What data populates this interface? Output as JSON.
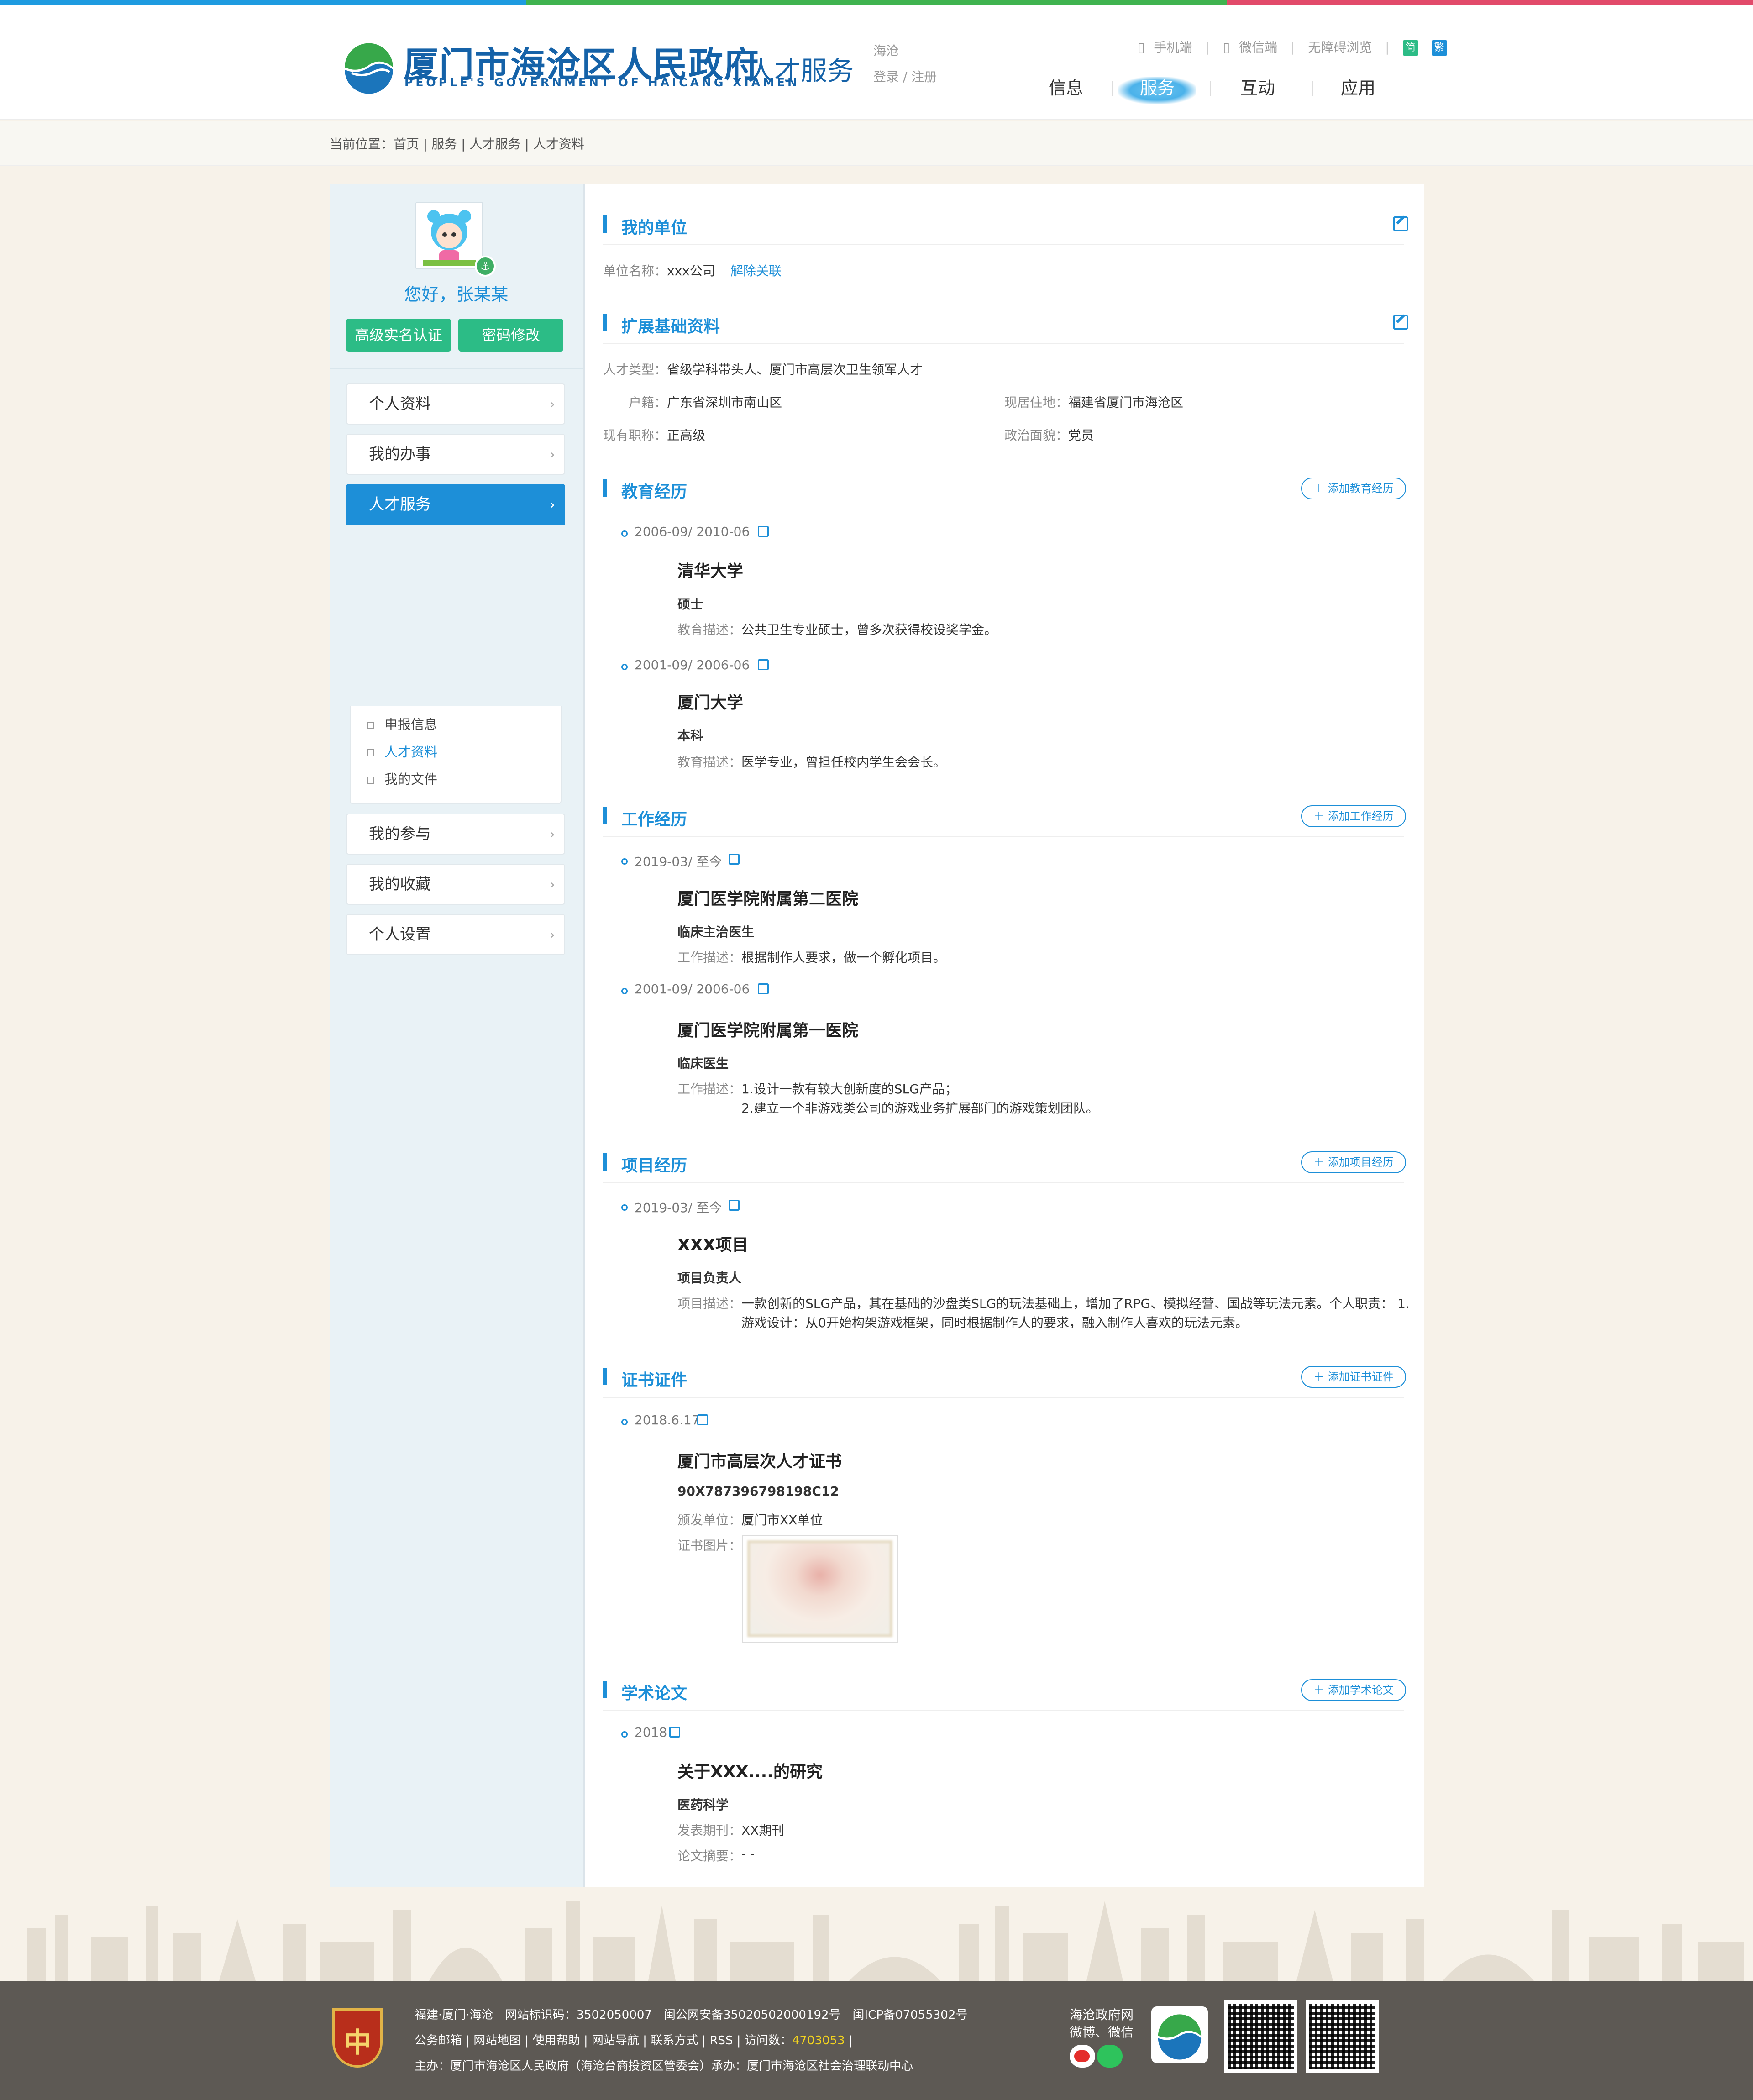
{
  "header": {
    "site_title": "厦门市海沧区人民政府",
    "site_title_en": "PEOPLE'S GOVERNMENT OF HAICANG XIAMEN",
    "section": "人才服务",
    "location": "海沧",
    "login": "登录 / 注册",
    "links": [
      "手机端",
      "微信端",
      "无障碍浏览"
    ],
    "lang_simplified": "简",
    "lang_traditional": "繁",
    "nav": [
      "信息",
      "服务",
      "互动",
      "应用"
    ],
    "nav_active": "服务",
    "colors": {
      "brand": "#1562a8",
      "accent": "#1d8fd8",
      "green": "#2cbc86"
    }
  },
  "breadcrumb": "当前位置：首页 | 服务 | 人才服务 | 人才资料",
  "sidebar": {
    "greeting": "您好，张某某",
    "btn_verify": "高级实名认证",
    "btn_password": "密码修改",
    "menu": [
      "个人资料",
      "我的办事",
      "人才服务",
      "我的参与",
      "我的收藏",
      "个人设置"
    ],
    "menu_active": "人才服务",
    "submenu": [
      "申报信息",
      "人才资料",
      "我的文件"
    ],
    "submenu_active": "人才资料"
  },
  "unit": {
    "title": "我的单位",
    "name_label": "单位名称：",
    "name_value": "xxx公司",
    "unlink": "解除关联"
  },
  "basic": {
    "title": "扩展基础资料",
    "type_label": "人才类型：",
    "type_value": "省级学科带头人、厦门市高层次卫生领军人才",
    "huji_label": "户籍：",
    "huji_value": "广东省深圳市南山区",
    "residence_label": "现居住地：",
    "residence_value": "福建省厦门市海沧区",
    "title_label": "现有职称：",
    "title_value": "正高级",
    "political_label": "政治面貌：",
    "political_value": "党员"
  },
  "education": {
    "title": "教育经历",
    "add": "添加教育经历",
    "items": [
      {
        "date": "2006-09/ 2010-06",
        "school": "清华大学",
        "degree": "硕士",
        "desc_label": "教育描述：",
        "desc": "公共卫生专业硕士，曾多次获得校设奖学金。"
      },
      {
        "date": "2001-09/ 2006-06",
        "school": "厦门大学",
        "degree": "本科",
        "desc_label": "教育描述：",
        "desc": "医学专业，曾担任校内学生会会长。"
      }
    ]
  },
  "work": {
    "title": "工作经历",
    "add": "添加工作经历",
    "items": [
      {
        "date": "2019-03/ 至今",
        "org": "厦门医学院附属第二医院",
        "role": "临床主治医生",
        "desc_label": "工作描述：",
        "desc": "根据制作人要求，做一个孵化项目。"
      },
      {
        "date": "2001-09/ 2006-06",
        "org": "厦门医学院附属第一医院",
        "role": "临床医生",
        "desc_label": "工作描述：",
        "desc1": "1.设计一款有较大创新度的SLG产品；",
        "desc2": "2.建立一个非游戏类公司的游戏业务扩展部门的游戏策划团队。"
      }
    ]
  },
  "project": {
    "title": "项目经历",
    "add": "添加项目经历",
    "date": "2019-03/ 至今",
    "name": "XXX项目",
    "role": "项目负责人",
    "desc_label": "项目描述：",
    "desc1": "一款创新的SLG产品，其在基础的沙盘类SLG的玩法基础上，增加了RPG、模拟经营、国战等玩法元素。个人职责： 1.",
    "desc2": "游戏设计：从0开始构架游戏框架，同时根据制作人的要求，融入制作人喜欢的玩法元素。"
  },
  "certificate": {
    "title": "证书证件",
    "add": "添加证书证件",
    "date": "2018.6.17",
    "name": "厦门市高层次人才证书",
    "number": "90X787396798198C12",
    "issuer_label": "颁发单位：",
    "issuer": "厦门市XX单位",
    "image_label": "证书图片："
  },
  "paper": {
    "title": "学术论文",
    "add": "添加学术论文",
    "date": "2018",
    "name": "关于XXX....的研究",
    "field": "医药科学",
    "journal_label": "发表期刊：",
    "journal": "XX期刊",
    "abstract_label": "论文摘要：",
    "abstract": "- -"
  },
  "footer": {
    "line1": "福建·厦门·海沧　网站标识码：3502050007　闽公网安备35020502000192号　闽ICP备07055302号",
    "line2_prefix": "公务邮箱 | 网站地图 | 使用帮助 | 网站导航 | 联系方式 | RSS | 访问数：",
    "visits": "4703053",
    "line2_suffix": " |",
    "line3": "主办：厦门市海沧区人民政府（海沧台商投资区管委会）承办：厦门市海沧区社会治理联动中心",
    "badge_text": "中",
    "social_1": "海沧政府网",
    "social_2": "微博、微信"
  }
}
